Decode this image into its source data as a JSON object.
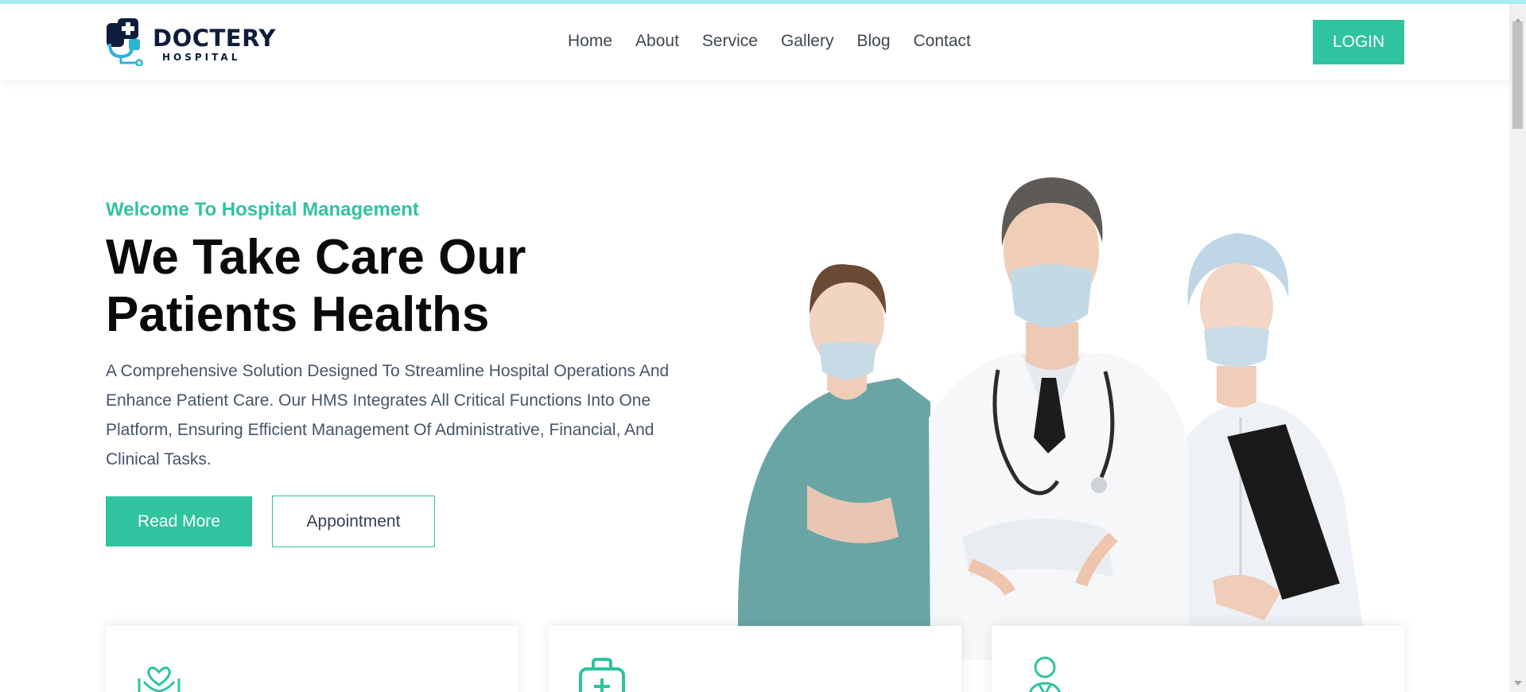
{
  "brand": {
    "name": "DOCTERY",
    "subtitle": "HOSPITAL",
    "accent_color": "#2fc3a0",
    "navy_color": "#0f1d3d"
  },
  "nav": {
    "items": [
      "Home",
      "About",
      "Service",
      "Gallery",
      "Blog",
      "Contact"
    ],
    "login_label": "LOGIN"
  },
  "hero": {
    "tagline": "Welcome To Hospital Management",
    "title": "We Take Care Our Patients Healths",
    "description": "A Comprehensive Solution Designed To Streamline Hospital Operations And Enhance Patient Care. Our HMS Integrates All Critical Functions Into One Platform, Ensuring Efficient Management Of Administrative, Financial, And Clinical Tasks.",
    "read_more_label": "Read More",
    "appointment_label": "Appointment",
    "image": "medical-staff-photo"
  },
  "feature_cards": [
    {
      "icon": "care-hands-heart-icon"
    },
    {
      "icon": "medical-kit-icon"
    },
    {
      "icon": "doctor-person-icon"
    }
  ]
}
